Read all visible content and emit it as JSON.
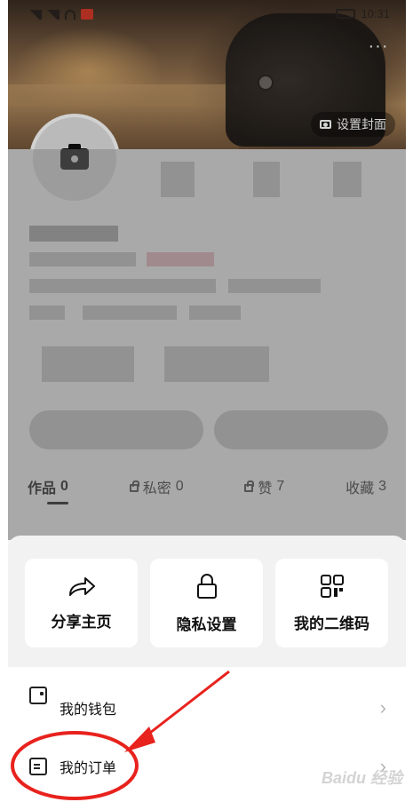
{
  "status_bar": {
    "time": "10:31"
  },
  "cover": {
    "set_cover_label": "设置封面",
    "more_glyph": "···"
  },
  "tabs": [
    {
      "label": "作品",
      "count": "0"
    },
    {
      "label": "私密",
      "count": "0"
    },
    {
      "label": "赞",
      "count": "7"
    },
    {
      "label": "收藏",
      "count": "3"
    }
  ],
  "sheet": {
    "actions": [
      {
        "label": "分享主页",
        "icon": "share-icon"
      },
      {
        "label": "隐私设置",
        "icon": "lock-icon"
      },
      {
        "label": "我的二维码",
        "icon": "qr-code-icon"
      }
    ],
    "menu": [
      {
        "label": "我的钱包",
        "icon": "wallet-icon"
      },
      {
        "label": "我的订单",
        "icon": "order-icon"
      }
    ]
  },
  "annotation": {
    "color": "#e8221d"
  },
  "watermark": {
    "text": "Baidu 经验"
  }
}
